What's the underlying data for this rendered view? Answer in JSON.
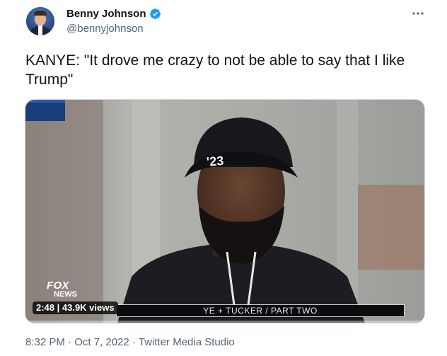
{
  "author": {
    "display_name": "Benny Johnson",
    "handle": "@bennyjohnson",
    "verified": true
  },
  "tweet": {
    "text": "KANYE: \"It drove me crazy to not be able to say that I like Trump\""
  },
  "media": {
    "watermark_line1": "FOX",
    "watermark_line2": "NEWS",
    "chyron": "YE + TUCKER / PART TWO",
    "view_badge": "2:48 | 43.9K views",
    "cap_text": "'23"
  },
  "meta": {
    "time": "8:32 PM",
    "separator": "·",
    "date": "Oct 7, 2022",
    "source": "Twitter Media Studio"
  },
  "colors": {
    "verified_blue": "#1d9bf0",
    "secondary_text": "#536471",
    "primary_text": "#0f1419"
  },
  "icons": [
    "verified-badge-icon",
    "more-options-icon",
    "fox-news-logo-icon"
  ]
}
